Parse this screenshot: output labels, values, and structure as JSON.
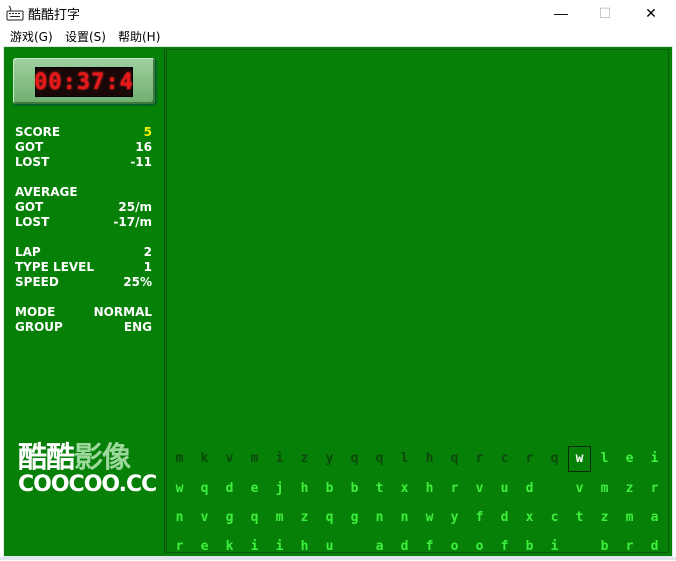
{
  "window": {
    "title": "酷酷打字",
    "controls": {
      "minimize": "—",
      "maximize": "☐",
      "close": "✕"
    }
  },
  "menu": [
    {
      "label": "游戏(G)"
    },
    {
      "label": "设置(S)"
    },
    {
      "label": "帮助(H)"
    }
  ],
  "timer": {
    "display": "00:37:4"
  },
  "stats": {
    "score": {
      "label": "SCORE",
      "value": "5"
    },
    "got": {
      "label": "GOT",
      "value": "16"
    },
    "lost": {
      "label": "LOST",
      "value": "-11"
    },
    "average_header": "AVERAGE",
    "avg_got": {
      "label": "GOT",
      "value": "25/m"
    },
    "avg_lost": {
      "label": "LOST",
      "value": "-17/m"
    },
    "lap": {
      "label": "LAP",
      "value": "2"
    },
    "type_level": {
      "label": "TYPE LEVEL",
      "value": "1"
    },
    "speed": {
      "label": "SPEED",
      "value": "25%"
    },
    "mode": {
      "label": "MODE",
      "value": "NORMAL"
    },
    "group": {
      "label": "GROUP",
      "value": "ENG"
    }
  },
  "logo": {
    "cn_a": "酷酷",
    "cn_b": "影像",
    "en": "COOCOO.CC"
  },
  "letter_rows": [
    {
      "state": "typed-then-pending",
      "chars": [
        "m",
        "k",
        "v",
        "m",
        "i",
        "z",
        "y",
        "q",
        "q",
        "l",
        "h",
        "q",
        "r",
        "c",
        "r",
        "q",
        "w",
        "l",
        "e",
        "i"
      ],
      "typed_count": 16,
      "current_index": 16
    },
    {
      "state": "pending",
      "chars": [
        "w",
        "q",
        "d",
        "e",
        "j",
        "h",
        "b",
        "b",
        "t",
        "x",
        "h",
        "r",
        "v",
        "u",
        "d",
        "",
        "v",
        "m",
        "z",
        "r"
      ]
    },
    {
      "state": "pending",
      "chars": [
        "n",
        "v",
        "g",
        "q",
        "m",
        "z",
        "q",
        "g",
        "n",
        "n",
        "w",
        "y",
        "f",
        "d",
        "x",
        "c",
        "t",
        "z",
        "m",
        "a"
      ]
    },
    {
      "state": "pending",
      "chars": [
        "r",
        "e",
        "k",
        "i",
        "i",
        "h",
        "u",
        "",
        "a",
        "d",
        "f",
        "o",
        "o",
        "f",
        "b",
        "i",
        "",
        "b",
        "r",
        "d"
      ]
    }
  ],
  "colors": {
    "background": "#078007",
    "pending_letter": "#3ef03e",
    "typed_letter": "#0a4a0a",
    "timer_red": "#e81818",
    "score_yellow": "#f4f400"
  }
}
